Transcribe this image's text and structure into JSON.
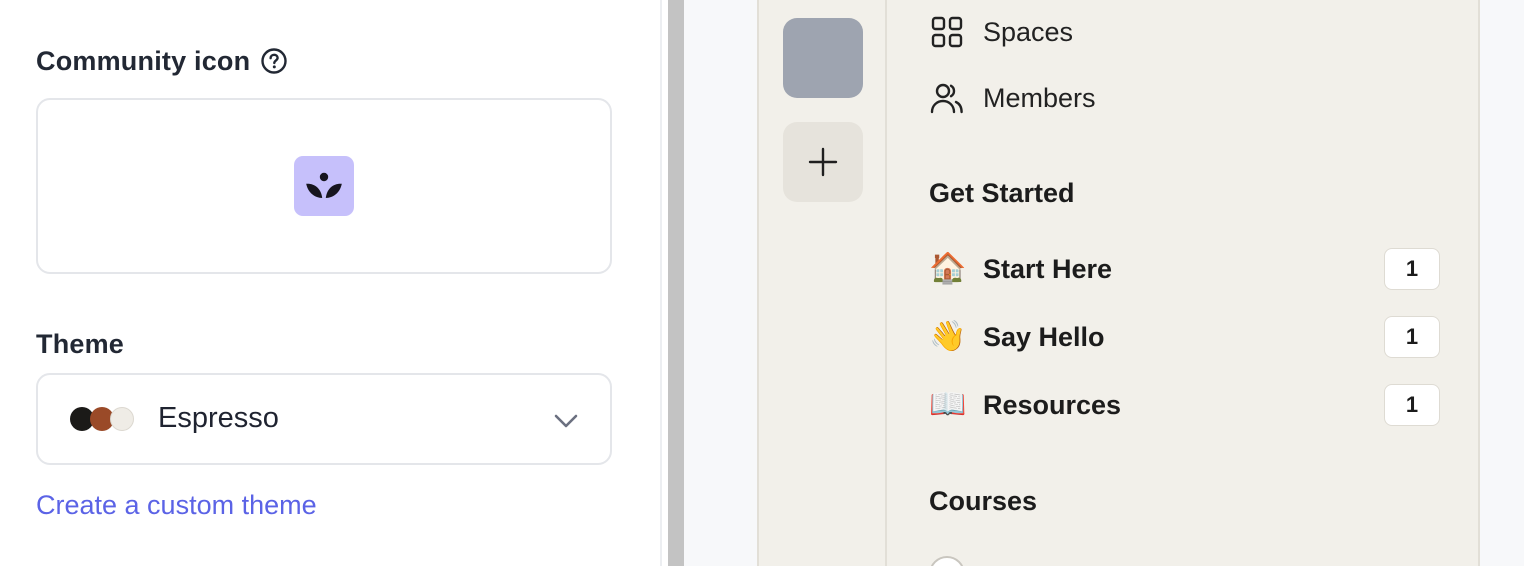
{
  "settings": {
    "community_icon_label": "Community icon",
    "theme_label": "Theme",
    "theme_value": "Espresso",
    "theme_swatches": [
      "#1b1a18",
      "#9a4a28",
      "#efece6"
    ],
    "icon_tile_color": "#c6c0fb",
    "custom_theme_link": "Create a custom theme",
    "link_color": "#5b63e6"
  },
  "preview": {
    "nav": [
      {
        "label": "Spaces",
        "icon": "grid-icon"
      },
      {
        "label": "Members",
        "icon": "members-icon"
      }
    ],
    "sections": [
      {
        "title": "Get Started",
        "items": [
          {
            "emoji": "🏠",
            "label": "Start Here",
            "count": "1"
          },
          {
            "emoji": "👋",
            "label": "Say Hello",
            "count": "1"
          },
          {
            "emoji": "📖",
            "label": "Resources",
            "count": "1"
          }
        ]
      },
      {
        "title": "Courses",
        "items": []
      }
    ],
    "community_tile_color": "#9ea4b0",
    "background_color": "#f2f0ea"
  }
}
